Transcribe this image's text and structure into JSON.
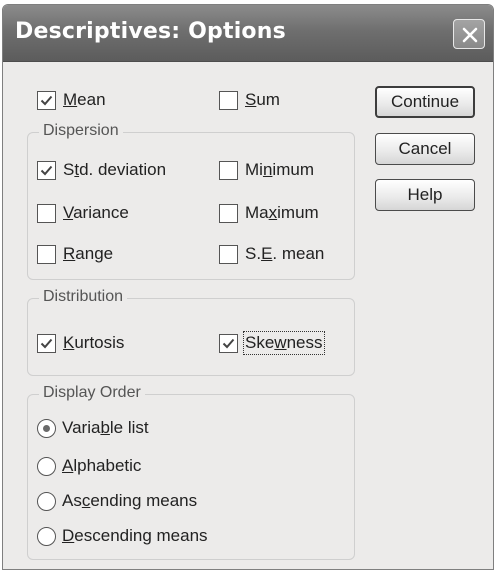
{
  "window": {
    "title": "Descriptives: Options"
  },
  "options": {
    "mean": {
      "pre": "",
      "key": "M",
      "post": "ean",
      "checked": true
    },
    "sum": {
      "pre": "",
      "key": "S",
      "post": "um",
      "checked": false
    }
  },
  "dispersion": {
    "legend": "Dispersion",
    "std_deviation": {
      "pre": "S",
      "key": "t",
      "post": "d. deviation",
      "checked": true
    },
    "minimum": {
      "pre": "Mi",
      "key": "n",
      "post": "imum",
      "checked": false
    },
    "variance": {
      "pre": "",
      "key": "V",
      "post": "ariance",
      "checked": false
    },
    "maximum": {
      "pre": "Ma",
      "key": "x",
      "post": "imum",
      "checked": false
    },
    "range": {
      "pre": "",
      "key": "R",
      "post": "ange",
      "checked": false
    },
    "se_mean": {
      "pre": "S.",
      "key": "E",
      "post": ". mean",
      "checked": false
    }
  },
  "distribution": {
    "legend": "Distribution",
    "kurtosis": {
      "pre": "",
      "key": "K",
      "post": "urtosis",
      "checked": true
    },
    "skewness": {
      "pre": "Ske",
      "key": "w",
      "post": "ness",
      "checked": true
    }
  },
  "display_order": {
    "legend": "Display Order",
    "selected": "variable_list",
    "variable_list": {
      "pre": "Varia",
      "key": "b",
      "post": "le list"
    },
    "alphabetic": {
      "pre": "",
      "key": "A",
      "post": "lphabetic"
    },
    "ascending": {
      "pre": "As",
      "key": "c",
      "post": "ending means"
    },
    "descending": {
      "pre": "",
      "key": "D",
      "post": "escending means"
    }
  },
  "buttons": {
    "continue": "Continue",
    "cancel": "Cancel",
    "help": "Help"
  }
}
